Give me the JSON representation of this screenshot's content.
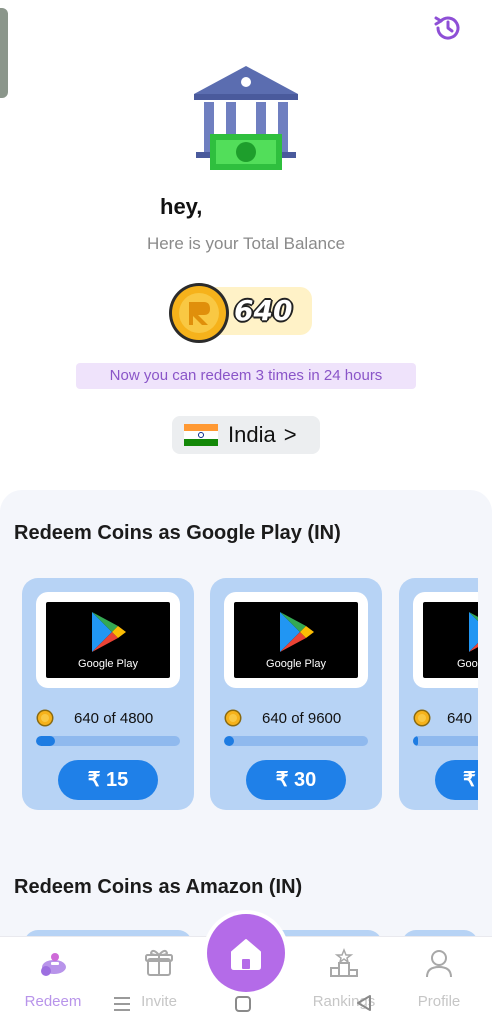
{
  "header": {
    "greeting": "hey,",
    "subtitle": "Here is your Total Balance"
  },
  "balance": {
    "value": "640"
  },
  "redeem_note": "Now you can redeem 3 times in 24 hours",
  "country": {
    "name": "India",
    "chevron": ">"
  },
  "sections": [
    {
      "title": "Redeem Coins as Google Play (IN)",
      "cards": [
        {
          "brand": "Google Play",
          "progress_text": "640 of 4800",
          "progress": 0.133,
          "button_label": "₹ 15"
        },
        {
          "brand": "Google Play",
          "progress_text": "640 of 9600",
          "progress": 0.067,
          "button_label": "₹ 30"
        },
        {
          "brand": "Goo",
          "progress_text": "640",
          "progress": 0.033,
          "button_label": "₹"
        }
      ]
    },
    {
      "title": "Redeem Coins as Amazon (IN)"
    }
  ],
  "nav": [
    {
      "label": "Redeem",
      "active": true
    },
    {
      "label": "Invite",
      "active": false
    },
    {
      "label": "",
      "active": false
    },
    {
      "label": "Rankings",
      "active": false
    },
    {
      "label": "Profile",
      "active": false
    }
  ],
  "system_nav": [
    "menu-icon",
    "square-icon",
    "back-icon"
  ],
  "colors": {
    "accent_purple": "#b46be8",
    "card_bg": "#b7d3f5",
    "button_blue": "#1f80e8",
    "note_text": "#8a55c8",
    "balance_pill": "#fff2c7"
  }
}
